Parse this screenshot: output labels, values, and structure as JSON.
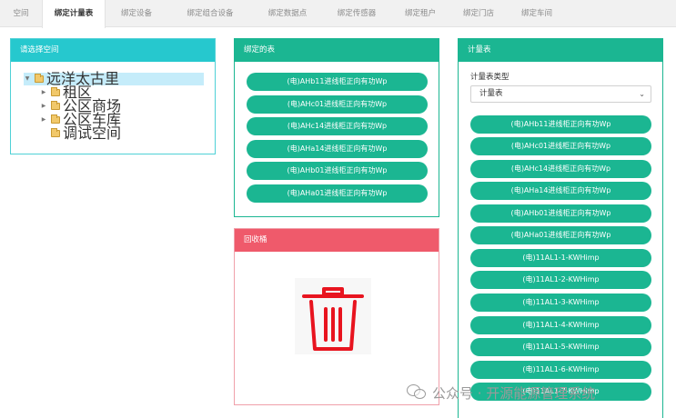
{
  "tabs": [
    {
      "label": "空间"
    },
    {
      "label": "绑定计量表"
    },
    {
      "label": "绑定设备"
    },
    {
      "label": "绑定组合设备"
    },
    {
      "label": "绑定数据点"
    },
    {
      "label": "绑定传感器"
    },
    {
      "label": "绑定租户"
    },
    {
      "label": "绑定门店"
    },
    {
      "label": "绑定车间"
    }
  ],
  "space_panel": {
    "title": "请选择空间",
    "tree": [
      {
        "label": "远洋太古里"
      },
      {
        "label": "租区"
      },
      {
        "label": "公区商场"
      },
      {
        "label": "公区车库"
      },
      {
        "label": "调试空间"
      }
    ]
  },
  "bound_panel": {
    "title": "绑定的表",
    "items": [
      {
        "label": "(电)AHb11进线柜正向有功Wp"
      },
      {
        "label": "(电)AHc01进线柜正向有功Wp"
      },
      {
        "label": "(电)AHc14进线柜正向有功Wp"
      },
      {
        "label": "(电)AHa14进线柜正向有功Wp"
      },
      {
        "label": "(电)AHb01进线柜正向有功Wp"
      },
      {
        "label": "(电)AHa01进线柜正向有功Wp"
      }
    ]
  },
  "recycle_panel": {
    "title": "回收桶",
    "icon": "trash-icon",
    "icon_color": "#e8141f"
  },
  "meter_panel": {
    "title": "计量表",
    "type_label": "计量表类型",
    "type_selected": "计量表",
    "items": [
      {
        "label": "(电)AHb11进线柜正向有功Wp"
      },
      {
        "label": "(电)AHc01进线柜正向有功Wp"
      },
      {
        "label": "(电)AHc14进线柜正向有功Wp"
      },
      {
        "label": "(电)AHa14进线柜正向有功Wp"
      },
      {
        "label": "(电)AHb01进线柜正向有功Wp"
      },
      {
        "label": "(电)AHa01进线柜正向有功Wp"
      },
      {
        "label": "(电)11AL1-1-KWHimp"
      },
      {
        "label": "(电)11AL1-2-KWHimp"
      },
      {
        "label": "(电)11AL1-3-KWHimp"
      },
      {
        "label": "(电)11AL1-4-KWHimp"
      },
      {
        "label": "(电)11AL1-5-KWHimp"
      },
      {
        "label": "(电)11AL1-6-KWHimp"
      },
      {
        "label": "(电)11AL1-7-KWHimp"
      }
    ]
  },
  "watermark": {
    "text": "公众号 · 开源能源管理系统"
  },
  "colors": {
    "green": "#1bb692",
    "teal": "#26c8ce",
    "red": "#ef5a6b"
  }
}
